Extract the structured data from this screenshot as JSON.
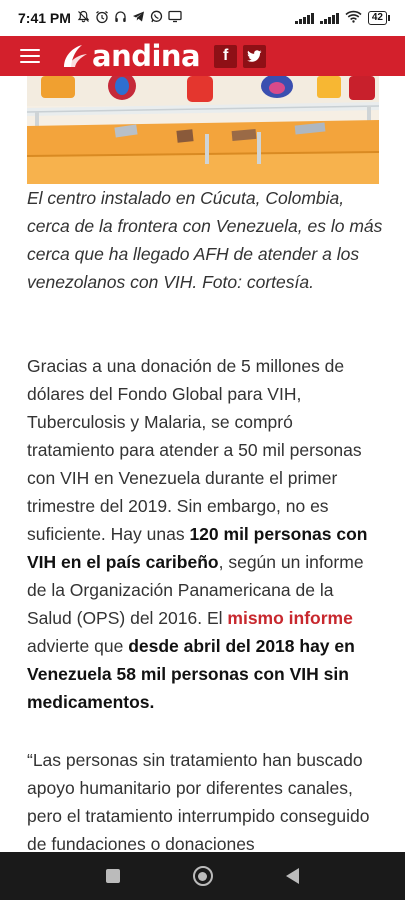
{
  "status_bar": {
    "time": "7:41 PM",
    "battery": "42",
    "icons": [
      "mute-icon",
      "alarm-icon",
      "headphones-icon",
      "telegram-icon",
      "whatsapp-icon",
      "screen-icon"
    ]
  },
  "header": {
    "brand": "andina",
    "facebook_label": "f",
    "twitter_label": "t",
    "brand_color": "#d3202c"
  },
  "article": {
    "caption": "El centro instalado en Cúcuta, Colombia, cerca de la frontera con Venezuela, es lo más cerca que ha llegado AFH de atender a los venezolanos con VIH. Foto: cortesía.",
    "p1_a": "Gracias a una donación de 5 millones de dólares del Fondo Global para VIH, Tuberculosis y Malaria, se compró tratamiento para atender a 50 mil personas con VIH en Venezuela durante el primer trimestre del 2019. Sin embargo, no es suficiente. Hay unas ",
    "p1_b": "120 mil personas con VIH en el país caribeño",
    "p1_c": ", según un informe de la Organización Panamericana de la Salud (OPS) del 2016. El ",
    "p1_link": "mismo informe",
    "p1_d": " advierte que ",
    "p1_e": "desde abril del 2018 hay en Venezuela 58 mil personas con VIH sin medicamentos.",
    "p2": "“Las personas sin tratamiento han buscado apoyo humanitario por diferentes canales, pero el tratamiento interrumpido conseguido de fundaciones o donaciones"
  },
  "nav": {
    "buttons": [
      "recents-button",
      "home-button",
      "back-button"
    ]
  }
}
